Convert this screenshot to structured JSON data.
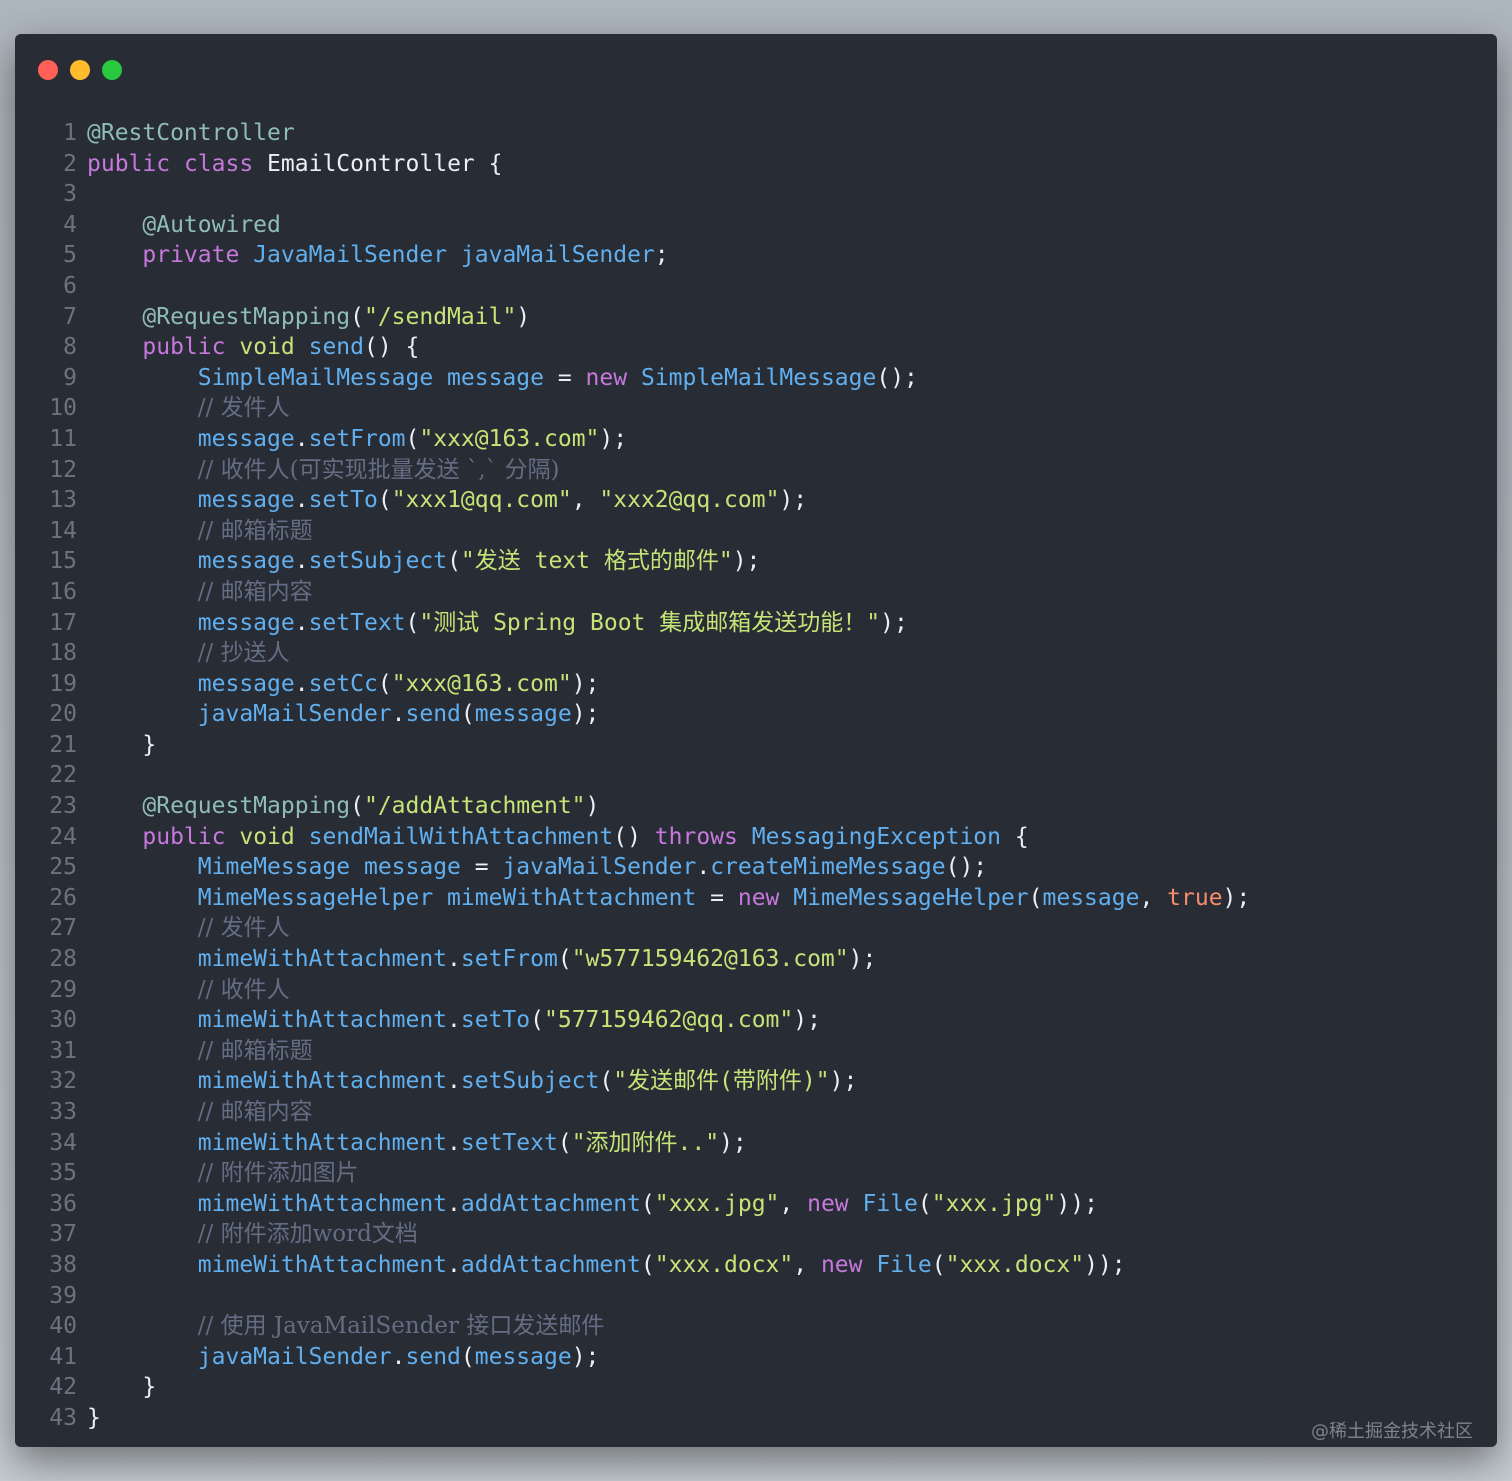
{
  "window": {
    "buttons": [
      "close",
      "minimize",
      "maximize"
    ],
    "colors": {
      "close": "#ff5f56",
      "minimize": "#ffbd2e",
      "maximize": "#27c93f",
      "background": "#282c34"
    }
  },
  "watermark": "@稀土掘金技术社区",
  "code": {
    "lines": [
      {
        "n": "1",
        "tokens": [
          {
            "c": "ann",
            "t": "@RestController"
          }
        ]
      },
      {
        "n": "2",
        "tokens": [
          {
            "c": "kw",
            "t": "public"
          },
          {
            "c": "plain",
            "t": " "
          },
          {
            "c": "kw",
            "t": "class"
          },
          {
            "c": "plain",
            "t": " EmailController {"
          }
        ]
      },
      {
        "n": "3",
        "tokens": []
      },
      {
        "n": "4",
        "tokens": [
          {
            "c": "plain",
            "t": "    "
          },
          {
            "c": "ann",
            "t": "@Autowired"
          }
        ]
      },
      {
        "n": "5",
        "tokens": [
          {
            "c": "plain",
            "t": "    "
          },
          {
            "c": "kw",
            "t": "private"
          },
          {
            "c": "plain",
            "t": " "
          },
          {
            "c": "type",
            "t": "JavaMailSender"
          },
          {
            "c": "plain",
            "t": " "
          },
          {
            "c": "var",
            "t": "javaMailSender"
          },
          {
            "c": "plain",
            "t": ";"
          }
        ]
      },
      {
        "n": "6",
        "tokens": []
      },
      {
        "n": "7",
        "tokens": [
          {
            "c": "plain",
            "t": "    "
          },
          {
            "c": "ann",
            "t": "@RequestMapping"
          },
          {
            "c": "plain",
            "t": "("
          },
          {
            "c": "str",
            "t": "\"/sendMail\""
          },
          {
            "c": "plain",
            "t": ")"
          }
        ]
      },
      {
        "n": "8",
        "tokens": [
          {
            "c": "plain",
            "t": "    "
          },
          {
            "c": "kw",
            "t": "public"
          },
          {
            "c": "plain",
            "t": " "
          },
          {
            "c": "str",
            "t": "void"
          },
          {
            "c": "plain",
            "t": " "
          },
          {
            "c": "fn",
            "t": "send"
          },
          {
            "c": "plain",
            "t": "() {"
          }
        ]
      },
      {
        "n": "9",
        "tokens": [
          {
            "c": "plain",
            "t": "        "
          },
          {
            "c": "type",
            "t": "SimpleMailMessage"
          },
          {
            "c": "plain",
            "t": " "
          },
          {
            "c": "var",
            "t": "message"
          },
          {
            "c": "plain",
            "t": " = "
          },
          {
            "c": "kw",
            "t": "new"
          },
          {
            "c": "plain",
            "t": " "
          },
          {
            "c": "type",
            "t": "SimpleMailMessage"
          },
          {
            "c": "plain",
            "t": "();"
          }
        ]
      },
      {
        "n": "10",
        "tokens": [
          {
            "c": "plain",
            "t": "        "
          },
          {
            "c": "cmt",
            "t": "// 发件人"
          }
        ]
      },
      {
        "n": "11",
        "tokens": [
          {
            "c": "plain",
            "t": "        "
          },
          {
            "c": "var",
            "t": "message"
          },
          {
            "c": "plain",
            "t": "."
          },
          {
            "c": "fn",
            "t": "setFrom"
          },
          {
            "c": "plain",
            "t": "("
          },
          {
            "c": "str",
            "t": "\"xxx@163.com\""
          },
          {
            "c": "plain",
            "t": ");"
          }
        ]
      },
      {
        "n": "12",
        "tokens": [
          {
            "c": "plain",
            "t": "        "
          },
          {
            "c": "cmt",
            "t": "// 收件人(可实现批量发送 `,` 分隔)"
          }
        ]
      },
      {
        "n": "13",
        "tokens": [
          {
            "c": "plain",
            "t": "        "
          },
          {
            "c": "var",
            "t": "message"
          },
          {
            "c": "plain",
            "t": "."
          },
          {
            "c": "fn",
            "t": "setTo"
          },
          {
            "c": "plain",
            "t": "("
          },
          {
            "c": "str",
            "t": "\"xxx1@qq.com\""
          },
          {
            "c": "plain",
            "t": ", "
          },
          {
            "c": "str",
            "t": "\"xxx2@qq.com\""
          },
          {
            "c": "plain",
            "t": ");"
          }
        ]
      },
      {
        "n": "14",
        "tokens": [
          {
            "c": "plain",
            "t": "        "
          },
          {
            "c": "cmt",
            "t": "// 邮箱标题"
          }
        ]
      },
      {
        "n": "15",
        "tokens": [
          {
            "c": "plain",
            "t": "        "
          },
          {
            "c": "var",
            "t": "message"
          },
          {
            "c": "plain",
            "t": "."
          },
          {
            "c": "fn",
            "t": "setSubject"
          },
          {
            "c": "plain",
            "t": "("
          },
          {
            "c": "str",
            "t": "\"发送 text 格式的邮件\""
          },
          {
            "c": "plain",
            "t": ");"
          }
        ]
      },
      {
        "n": "16",
        "tokens": [
          {
            "c": "plain",
            "t": "        "
          },
          {
            "c": "cmt",
            "t": "// 邮箱内容"
          }
        ]
      },
      {
        "n": "17",
        "tokens": [
          {
            "c": "plain",
            "t": "        "
          },
          {
            "c": "var",
            "t": "message"
          },
          {
            "c": "plain",
            "t": "."
          },
          {
            "c": "fn",
            "t": "setText"
          },
          {
            "c": "plain",
            "t": "("
          },
          {
            "c": "str",
            "t": "\"测试 Spring Boot 集成邮箱发送功能！\""
          },
          {
            "c": "plain",
            "t": ");"
          }
        ]
      },
      {
        "n": "18",
        "tokens": [
          {
            "c": "plain",
            "t": "        "
          },
          {
            "c": "cmt",
            "t": "// 抄送人"
          }
        ]
      },
      {
        "n": "19",
        "tokens": [
          {
            "c": "plain",
            "t": "        "
          },
          {
            "c": "var",
            "t": "message"
          },
          {
            "c": "plain",
            "t": "."
          },
          {
            "c": "fn",
            "t": "setCc"
          },
          {
            "c": "plain",
            "t": "("
          },
          {
            "c": "str",
            "t": "\"xxx@163.com\""
          },
          {
            "c": "plain",
            "t": ");"
          }
        ]
      },
      {
        "n": "20",
        "tokens": [
          {
            "c": "plain",
            "t": "        "
          },
          {
            "c": "var",
            "t": "javaMailSender"
          },
          {
            "c": "plain",
            "t": "."
          },
          {
            "c": "fn",
            "t": "send"
          },
          {
            "c": "plain",
            "t": "("
          },
          {
            "c": "var",
            "t": "message"
          },
          {
            "c": "plain",
            "t": ");"
          }
        ]
      },
      {
        "n": "21",
        "tokens": [
          {
            "c": "plain",
            "t": "    }"
          }
        ]
      },
      {
        "n": "22",
        "tokens": []
      },
      {
        "n": "23",
        "tokens": [
          {
            "c": "plain",
            "t": "    "
          },
          {
            "c": "ann",
            "t": "@RequestMapping"
          },
          {
            "c": "plain",
            "t": "("
          },
          {
            "c": "str",
            "t": "\"/addAttachment\""
          },
          {
            "c": "plain",
            "t": ")"
          }
        ]
      },
      {
        "n": "24",
        "tokens": [
          {
            "c": "plain",
            "t": "    "
          },
          {
            "c": "kw",
            "t": "public"
          },
          {
            "c": "plain",
            "t": " "
          },
          {
            "c": "str",
            "t": "void"
          },
          {
            "c": "plain",
            "t": " "
          },
          {
            "c": "fn",
            "t": "sendMailWithAttachment"
          },
          {
            "c": "plain",
            "t": "() "
          },
          {
            "c": "kw",
            "t": "throws"
          },
          {
            "c": "plain",
            "t": " "
          },
          {
            "c": "type",
            "t": "MessagingException"
          },
          {
            "c": "plain",
            "t": " {"
          }
        ]
      },
      {
        "n": "25",
        "tokens": [
          {
            "c": "plain",
            "t": "        "
          },
          {
            "c": "type",
            "t": "MimeMessage"
          },
          {
            "c": "plain",
            "t": " "
          },
          {
            "c": "var",
            "t": "message"
          },
          {
            "c": "plain",
            "t": " = "
          },
          {
            "c": "var",
            "t": "javaMailSender"
          },
          {
            "c": "plain",
            "t": "."
          },
          {
            "c": "fn",
            "t": "createMimeMessage"
          },
          {
            "c": "plain",
            "t": "();"
          }
        ]
      },
      {
        "n": "26",
        "tokens": [
          {
            "c": "plain",
            "t": "        "
          },
          {
            "c": "type",
            "t": "MimeMessageHelper"
          },
          {
            "c": "plain",
            "t": " "
          },
          {
            "c": "var",
            "t": "mimeWithAttachment"
          },
          {
            "c": "plain",
            "t": " = "
          },
          {
            "c": "kw",
            "t": "new"
          },
          {
            "c": "plain",
            "t": " "
          },
          {
            "c": "type",
            "t": "MimeMessageHelper"
          },
          {
            "c": "plain",
            "t": "("
          },
          {
            "c": "var",
            "t": "message"
          },
          {
            "c": "plain",
            "t": ", "
          },
          {
            "c": "bool",
            "t": "true"
          },
          {
            "c": "plain",
            "t": ");"
          }
        ]
      },
      {
        "n": "27",
        "tokens": [
          {
            "c": "plain",
            "t": "        "
          },
          {
            "c": "cmt",
            "t": "// 发件人"
          }
        ]
      },
      {
        "n": "28",
        "tokens": [
          {
            "c": "plain",
            "t": "        "
          },
          {
            "c": "var",
            "t": "mimeWithAttachment"
          },
          {
            "c": "plain",
            "t": "."
          },
          {
            "c": "fn",
            "t": "setFrom"
          },
          {
            "c": "plain",
            "t": "("
          },
          {
            "c": "str",
            "t": "\"w577159462@163.com\""
          },
          {
            "c": "plain",
            "t": ");"
          }
        ]
      },
      {
        "n": "29",
        "tokens": [
          {
            "c": "plain",
            "t": "        "
          },
          {
            "c": "cmt",
            "t": "// 收件人"
          }
        ]
      },
      {
        "n": "30",
        "tokens": [
          {
            "c": "plain",
            "t": "        "
          },
          {
            "c": "var",
            "t": "mimeWithAttachment"
          },
          {
            "c": "plain",
            "t": "."
          },
          {
            "c": "fn",
            "t": "setTo"
          },
          {
            "c": "plain",
            "t": "("
          },
          {
            "c": "str",
            "t": "\"577159462@qq.com\""
          },
          {
            "c": "plain",
            "t": ");"
          }
        ]
      },
      {
        "n": "31",
        "tokens": [
          {
            "c": "plain",
            "t": "        "
          },
          {
            "c": "cmt",
            "t": "// 邮箱标题"
          }
        ]
      },
      {
        "n": "32",
        "tokens": [
          {
            "c": "plain",
            "t": "        "
          },
          {
            "c": "var",
            "t": "mimeWithAttachment"
          },
          {
            "c": "plain",
            "t": "."
          },
          {
            "c": "fn",
            "t": "setSubject"
          },
          {
            "c": "plain",
            "t": "("
          },
          {
            "c": "str",
            "t": "\"发送邮件(带附件)\""
          },
          {
            "c": "plain",
            "t": ");"
          }
        ]
      },
      {
        "n": "33",
        "tokens": [
          {
            "c": "plain",
            "t": "        "
          },
          {
            "c": "cmt",
            "t": "// 邮箱内容"
          }
        ]
      },
      {
        "n": "34",
        "tokens": [
          {
            "c": "plain",
            "t": "        "
          },
          {
            "c": "var",
            "t": "mimeWithAttachment"
          },
          {
            "c": "plain",
            "t": "."
          },
          {
            "c": "fn",
            "t": "setText"
          },
          {
            "c": "plain",
            "t": "("
          },
          {
            "c": "str",
            "t": "\"添加附件..\""
          },
          {
            "c": "plain",
            "t": ");"
          }
        ]
      },
      {
        "n": "35",
        "tokens": [
          {
            "c": "plain",
            "t": "        "
          },
          {
            "c": "cmt",
            "t": "// 附件添加图片"
          }
        ]
      },
      {
        "n": "36",
        "tokens": [
          {
            "c": "plain",
            "t": "        "
          },
          {
            "c": "var",
            "t": "mimeWithAttachment"
          },
          {
            "c": "plain",
            "t": "."
          },
          {
            "c": "fn",
            "t": "addAttachment"
          },
          {
            "c": "plain",
            "t": "("
          },
          {
            "c": "str",
            "t": "\"xxx.jpg\""
          },
          {
            "c": "plain",
            "t": ", "
          },
          {
            "c": "kw",
            "t": "new"
          },
          {
            "c": "plain",
            "t": " "
          },
          {
            "c": "type",
            "t": "File"
          },
          {
            "c": "plain",
            "t": "("
          },
          {
            "c": "str",
            "t": "\"xxx.jpg\""
          },
          {
            "c": "plain",
            "t": "));"
          }
        ]
      },
      {
        "n": "37",
        "tokens": [
          {
            "c": "plain",
            "t": "        "
          },
          {
            "c": "cmt",
            "t": "// 附件添加word文档"
          }
        ]
      },
      {
        "n": "38",
        "tokens": [
          {
            "c": "plain",
            "t": "        "
          },
          {
            "c": "var",
            "t": "mimeWithAttachment"
          },
          {
            "c": "plain",
            "t": "."
          },
          {
            "c": "fn",
            "t": "addAttachment"
          },
          {
            "c": "plain",
            "t": "("
          },
          {
            "c": "str",
            "t": "\"xxx.docx\""
          },
          {
            "c": "plain",
            "t": ", "
          },
          {
            "c": "kw",
            "t": "new"
          },
          {
            "c": "plain",
            "t": " "
          },
          {
            "c": "type",
            "t": "File"
          },
          {
            "c": "plain",
            "t": "("
          },
          {
            "c": "str",
            "t": "\"xxx.docx\""
          },
          {
            "c": "plain",
            "t": "));"
          }
        ]
      },
      {
        "n": "39",
        "tokens": []
      },
      {
        "n": "40",
        "tokens": [
          {
            "c": "plain",
            "t": "        "
          },
          {
            "c": "cmt",
            "t": "// 使用 JavaMailSender 接口发送邮件"
          }
        ]
      },
      {
        "n": "41",
        "tokens": [
          {
            "c": "plain",
            "t": "        "
          },
          {
            "c": "var",
            "t": "javaMailSender"
          },
          {
            "c": "plain",
            "t": "."
          },
          {
            "c": "fn",
            "t": "send"
          },
          {
            "c": "plain",
            "t": "("
          },
          {
            "c": "var",
            "t": "message"
          },
          {
            "c": "plain",
            "t": ");"
          }
        ]
      },
      {
        "n": "42",
        "tokens": [
          {
            "c": "plain",
            "t": "    }"
          }
        ]
      },
      {
        "n": "43",
        "tokens": [
          {
            "c": "plain",
            "t": "}"
          }
        ]
      }
    ]
  }
}
